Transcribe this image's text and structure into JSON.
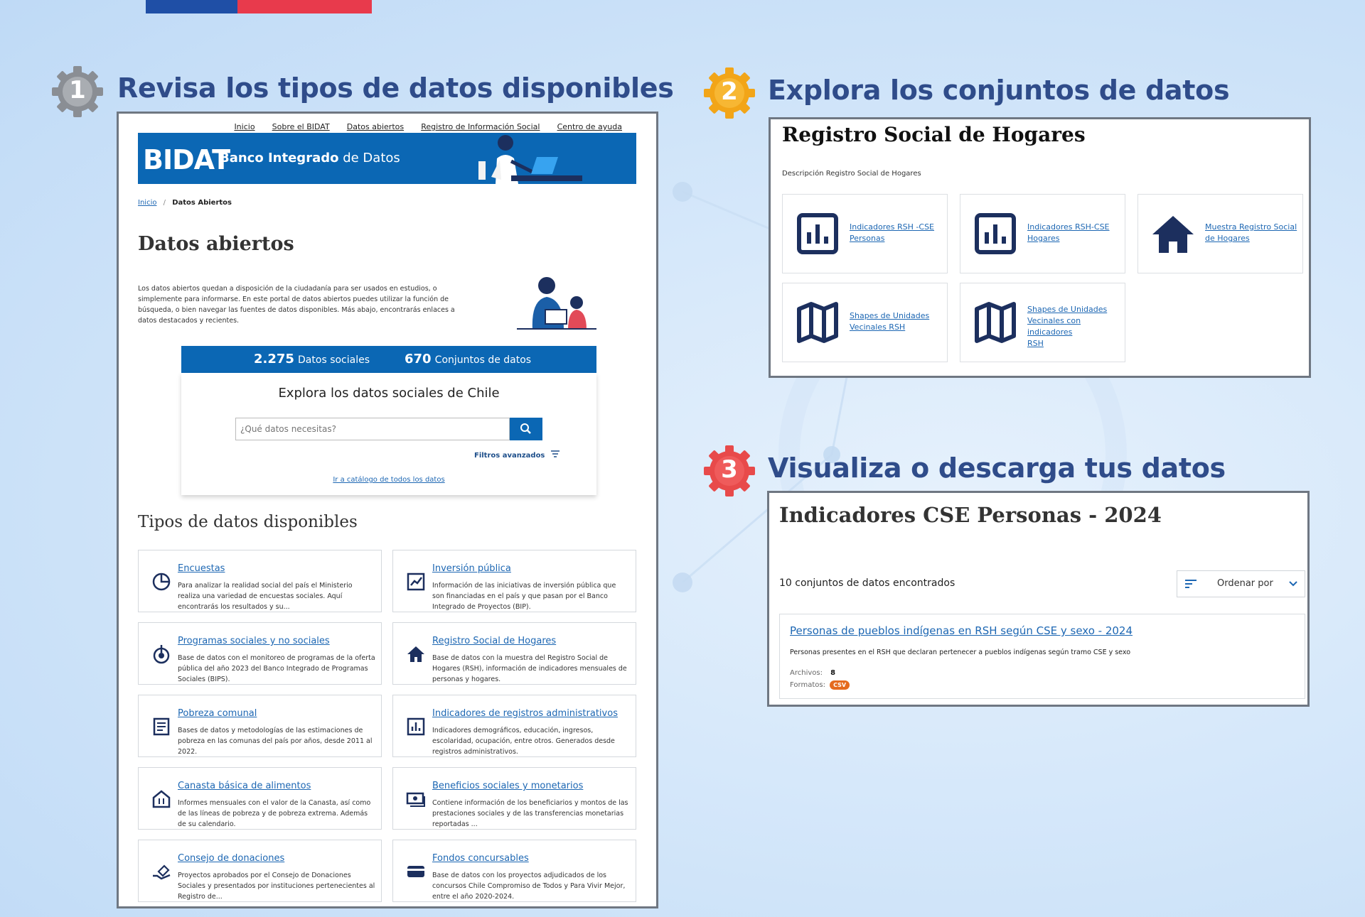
{
  "steps": [
    {
      "number": "1",
      "title": "Revisa los tipos de datos disponibles",
      "color": "#8a8e94"
    },
    {
      "number": "2",
      "title": "Explora los conjuntos de datos",
      "color": "#f2a518"
    },
    {
      "number": "3",
      "title": "Visualiza o descarga tus datos",
      "color": "#e84a4a"
    }
  ],
  "panel1": {
    "nav": [
      "Inicio",
      "Sobre el BIDAT",
      "Datos abiertos",
      "Registro de Información Social",
      "Centro de ayuda"
    ],
    "banner": {
      "logo": "BIDAT",
      "name_a": "Banco Integrado",
      "name_b": "de Datos",
      "color": "#0b67b4"
    },
    "breadcrumb": {
      "home": "Inicio",
      "sep": "/",
      "current": "Datos Abiertos"
    },
    "page_title": "Datos abiertos",
    "intro": "Los datos abiertos quedan a disposición de la ciudadanía para ser usados en estudios, o simplemente para informarse. En este portal de datos abiertos puedes utilizar la función de búsqueda, o bien navegar las fuentes de datos disponibles. Más abajo, encontrarás enlaces a datos destacados y recientes.",
    "stats": {
      "social_count": "2.275",
      "social_label": "Datos sociales",
      "sets_count": "670",
      "sets_label": "Conjuntos de datos"
    },
    "search": {
      "title": "Explora los datos sociales de Chile",
      "placeholder": "¿Qué datos necesitas?",
      "filters_label": "Filtros avanzados",
      "catalog_link": "Ir a catálogo de todos los datos"
    },
    "types_title": "Tipos de datos disponibles",
    "types": [
      {
        "icon": "pie-chart-icon",
        "title": "Encuestas",
        "desc": "Para analizar la realidad social del país el Ministerio realiza una variedad de encuestas sociales. Aquí encontrarás los resultados y su..."
      },
      {
        "icon": "line-chart-icon",
        "title": "Inversión pública",
        "desc": "Información de las iniciativas de inversión pública que son financiadas en el país y que pasan por el Banco Integrado de Proyectos (BIP)."
      },
      {
        "icon": "target-hand-icon",
        "title": "Programas sociales y no sociales",
        "desc": "Base de datos con el monitoreo de programas de la oferta pública del año 2023 del Banco Integrado de Programas Sociales (BIPS)."
      },
      {
        "icon": "house-icon",
        "title": "Registro Social de Hogares",
        "desc": "Base de datos con la muestra del Registro Social de Hogares (RSH), información de indicadores mensuales de personas y hogares."
      },
      {
        "icon": "document-icon",
        "title": "Pobreza comunal",
        "desc": "Bases de datos y metodologías de las estimaciones de pobreza en las comunas del país por años, desde 2011 al 2022."
      },
      {
        "icon": "bar-chart-icon",
        "title": "Indicadores de registros administrativos",
        "desc": "Indicadores demográficos, educación, ingresos, escolaridad, ocupación, entre otros. Generados desde registros administrativos."
      },
      {
        "icon": "food-basket-icon",
        "title": "Canasta básica de alimentos",
        "desc": "Informes mensuales con el valor de la Canasta, así como de las líneas de pobreza y de pobreza extrema. Además de su calendario."
      },
      {
        "icon": "money-icon",
        "title": "Beneficios sociales y monetarios",
        "desc": "Contiene información de los beneficiarios y montos de las prestaciones sociales y de las transferencias monetarias reportadas ..."
      },
      {
        "icon": "donation-hand-icon",
        "title": "Consejo de donaciones",
        "desc": "Proyectos aprobados por el Consejo de Donaciones Sociales y presentados por instituciones pertenecientes al Registro de..."
      },
      {
        "icon": "wallet-icon",
        "title": "Fondos concursables",
        "desc": "Base de datos con los proyectos adjudicados de los concursos Chile Compromiso de Todos y Para Vivir Mejor, entre el año 2020-2024."
      }
    ]
  },
  "panel2": {
    "title": "Registro Social de Hogares",
    "desc": "Descripción Registro Social de Hogares",
    "datasets": [
      {
        "icon": "bar-chart-icon",
        "lines": [
          "Indicadores RSH -CSE",
          "Personas"
        ]
      },
      {
        "icon": "bar-chart-icon",
        "lines": [
          "Indicadores RSH-CSE",
          "Hogares"
        ]
      },
      {
        "icon": "house-icon",
        "lines": [
          "Muestra Registro Social",
          "de Hogares"
        ]
      },
      {
        "icon": "map-icon",
        "lines": [
          "Shapes de Unidades",
          "Vecinales RSH"
        ]
      },
      {
        "icon": "map-icon",
        "lines": [
          "Shapes de Unidades",
          "Vecinales con indicadores",
          "RSH"
        ]
      }
    ]
  },
  "panel3": {
    "title": "Indicadores CSE Personas - 2024",
    "found": "10 conjuntos de datos encontrados",
    "sort_label": "Ordenar por",
    "result": {
      "title": "Personas de pueblos indígenas en RSH según CSE y sexo - 2024",
      "desc": "Personas presentes en el RSH que declaran pertenecer a pueblos indígenas según tramo CSE y sexo",
      "files_label": "Archivos:",
      "files_value": "8",
      "formats_label": "Formatos:",
      "format_badge": "CSV"
    }
  }
}
